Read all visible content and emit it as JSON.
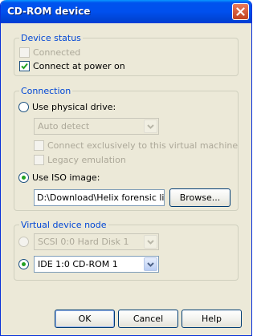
{
  "window": {
    "title": "CD-ROM device"
  },
  "device_status": {
    "legend": "Device status",
    "connected_label": "Connected",
    "connect_power_label": "Connect at power on",
    "connect_power_checked": true
  },
  "connection": {
    "legend": "Connection",
    "physical_label": "Use physical drive:",
    "physical_drive_value": "Auto detect",
    "exclusive_label": "Connect exclusively to this virtual machine",
    "legacy_label": "Legacy emulation",
    "iso_label": "Use ISO image:",
    "iso_path": "D:\\Download\\Helix forensic live",
    "browse_label": "Browse..."
  },
  "node": {
    "legend": "Virtual device node",
    "scsi_value": "SCSI 0:0  Hard Disk 1",
    "ide_value": "IDE 1:0  CD-ROM 1"
  },
  "buttons": {
    "ok": "OK",
    "cancel": "Cancel",
    "help": "Help"
  },
  "colors": {
    "title_bar": "#0054e3",
    "legend_text": "#0046d5",
    "window_bg": "#ece9d8",
    "radio_dot": "#21a121"
  },
  "icons": {
    "close": "close-icon",
    "dropdown": "chevron-down-icon",
    "check": "checkmark-icon"
  }
}
